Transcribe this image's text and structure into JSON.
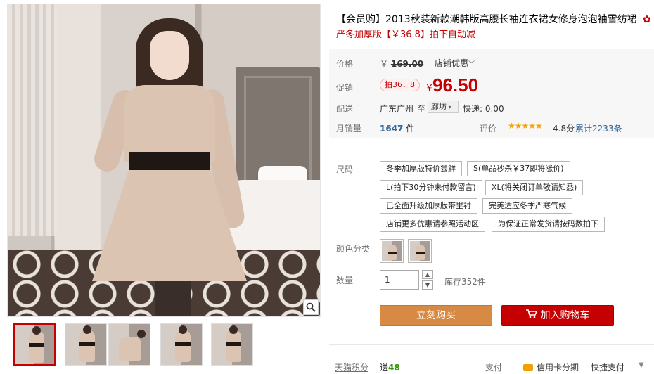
{
  "product": {
    "title": "【会员购】2013秋装新款潮韩版高腰长袖连衣裙女修身泡泡袖雪纺裙",
    "subtitle": "严冬加厚版【￥36.8】拍下自动减"
  },
  "price": {
    "label": "价格",
    "currency": "￥",
    "original": "169.00",
    "store_promo": "店铺优惠"
  },
  "promo": {
    "label": "促销",
    "tag": "拍36．8",
    "currency": "￥",
    "price": "96.50"
  },
  "delivery": {
    "label": "配送",
    "from": "广东广州",
    "to_word": "至",
    "destination": "廊坊",
    "shipping": "快递: 0.00"
  },
  "sales": {
    "label": "月销量",
    "count": "1647",
    "unit": "件",
    "rating_label": "评价",
    "stars": "★★★★★",
    "rating_value": 4.8,
    "rating": "4.8分",
    "reviews": "累计2233条"
  },
  "sku": {
    "label": "尺码",
    "options": [
      "冬季加厚版特价尝鲜",
      "S(单品秒杀￥37即将涨价)",
      "L(拍下30分钟未付款留言)",
      "XL(将关闭订单敬请知悉)",
      "已全面升级加厚版带里衬",
      "完美适应冬季严寒气候",
      "店铺更多优惠请参照活动区",
      "为保证正常发货请按码数拍下"
    ]
  },
  "color": {
    "label": "颜色分类"
  },
  "quantity": {
    "label": "数量",
    "value": "1",
    "stock": "库存352件"
  },
  "actions": {
    "buy": "立刻购买",
    "cart": "加入购物车"
  },
  "footer": {
    "points_label": "天猫积分",
    "points_prefix": "送",
    "points_value": "48",
    "pay_label": "支付",
    "pay_card": "信用卡分期",
    "pay_fast": "快捷支付"
  },
  "colors": {
    "accent": "#c40000",
    "buy_button": "#d78a44",
    "stars": "#f5a300",
    "link": "#336699",
    "points": "#339900"
  },
  "icons": {
    "zoom": "magnifier-icon",
    "cart": "shopping-cart-icon",
    "dropdown": "chevron-down-icon",
    "title_badge": "decoration-icon"
  }
}
